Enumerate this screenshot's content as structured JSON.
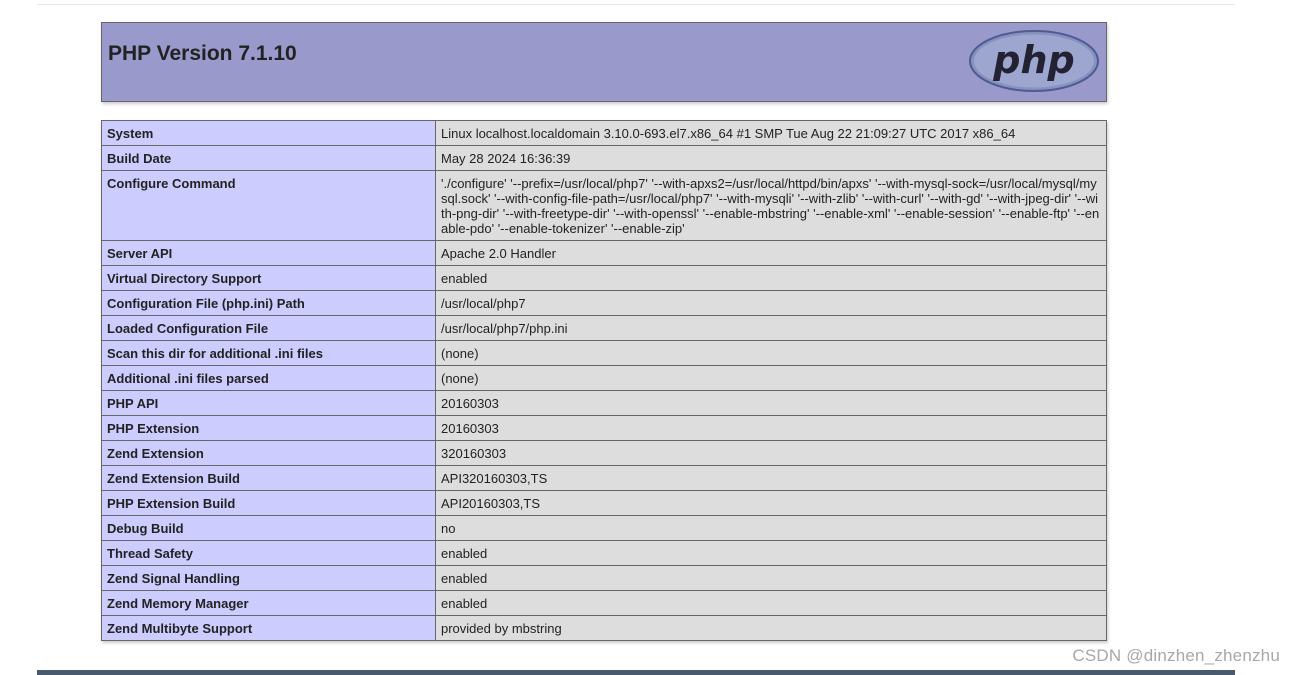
{
  "header": {
    "title": "PHP Version 7.1.10",
    "logo_text": "php"
  },
  "colors": {
    "header_bg": "#9999cc",
    "key_cell_bg": "#ccccff",
    "value_cell_bg": "#dddddd",
    "border": "#666666"
  },
  "rows": [
    {
      "key": "System",
      "value": "Linux localhost.localdomain 3.10.0-693.el7.x86_64 #1 SMP Tue Aug 22 21:09:27 UTC 2017 x86_64"
    },
    {
      "key": "Build Date",
      "value": "May 28 2024 16:36:39"
    },
    {
      "key": "Configure Command",
      "value": "'./configure' '--prefix=/usr/local/php7' '--with-apxs2=/usr/local/httpd/bin/apxs' '--with-mysql-sock=/usr/local/mysql/mysql.sock' '--with-config-file-path=/usr/local/php7' '--with-mysqli' '--with-zlib' '--with-curl' '--with-gd' '--with-jpeg-dir' '--with-png-dir' '--with-freetype-dir' '--with-openssl' '--enable-mbstring' '--enable-xml' '--enable-session' '--enable-ftp' '--enable-pdo' '--enable-tokenizer' '--enable-zip'"
    },
    {
      "key": "Server API",
      "value": "Apache 2.0 Handler"
    },
    {
      "key": "Virtual Directory Support",
      "value": "enabled"
    },
    {
      "key": "Configuration File (php.ini) Path",
      "value": "/usr/local/php7"
    },
    {
      "key": "Loaded Configuration File",
      "value": "/usr/local/php7/php.ini"
    },
    {
      "key": "Scan this dir for additional .ini files",
      "value": "(none)"
    },
    {
      "key": "Additional .ini files parsed",
      "value": "(none)"
    },
    {
      "key": "PHP API",
      "value": "20160303"
    },
    {
      "key": "PHP Extension",
      "value": "20160303"
    },
    {
      "key": "Zend Extension",
      "value": "320160303"
    },
    {
      "key": "Zend Extension Build",
      "value": "API320160303,TS"
    },
    {
      "key": "PHP Extension Build",
      "value": "API20160303,TS"
    },
    {
      "key": "Debug Build",
      "value": "no"
    },
    {
      "key": "Thread Safety",
      "value": "enabled"
    },
    {
      "key": "Zend Signal Handling",
      "value": "enabled"
    },
    {
      "key": "Zend Memory Manager",
      "value": "enabled"
    },
    {
      "key": "Zend Multibyte Support",
      "value": "provided by mbstring"
    }
  ],
  "watermark": "CSDN @dinzhen_zhenzhu"
}
